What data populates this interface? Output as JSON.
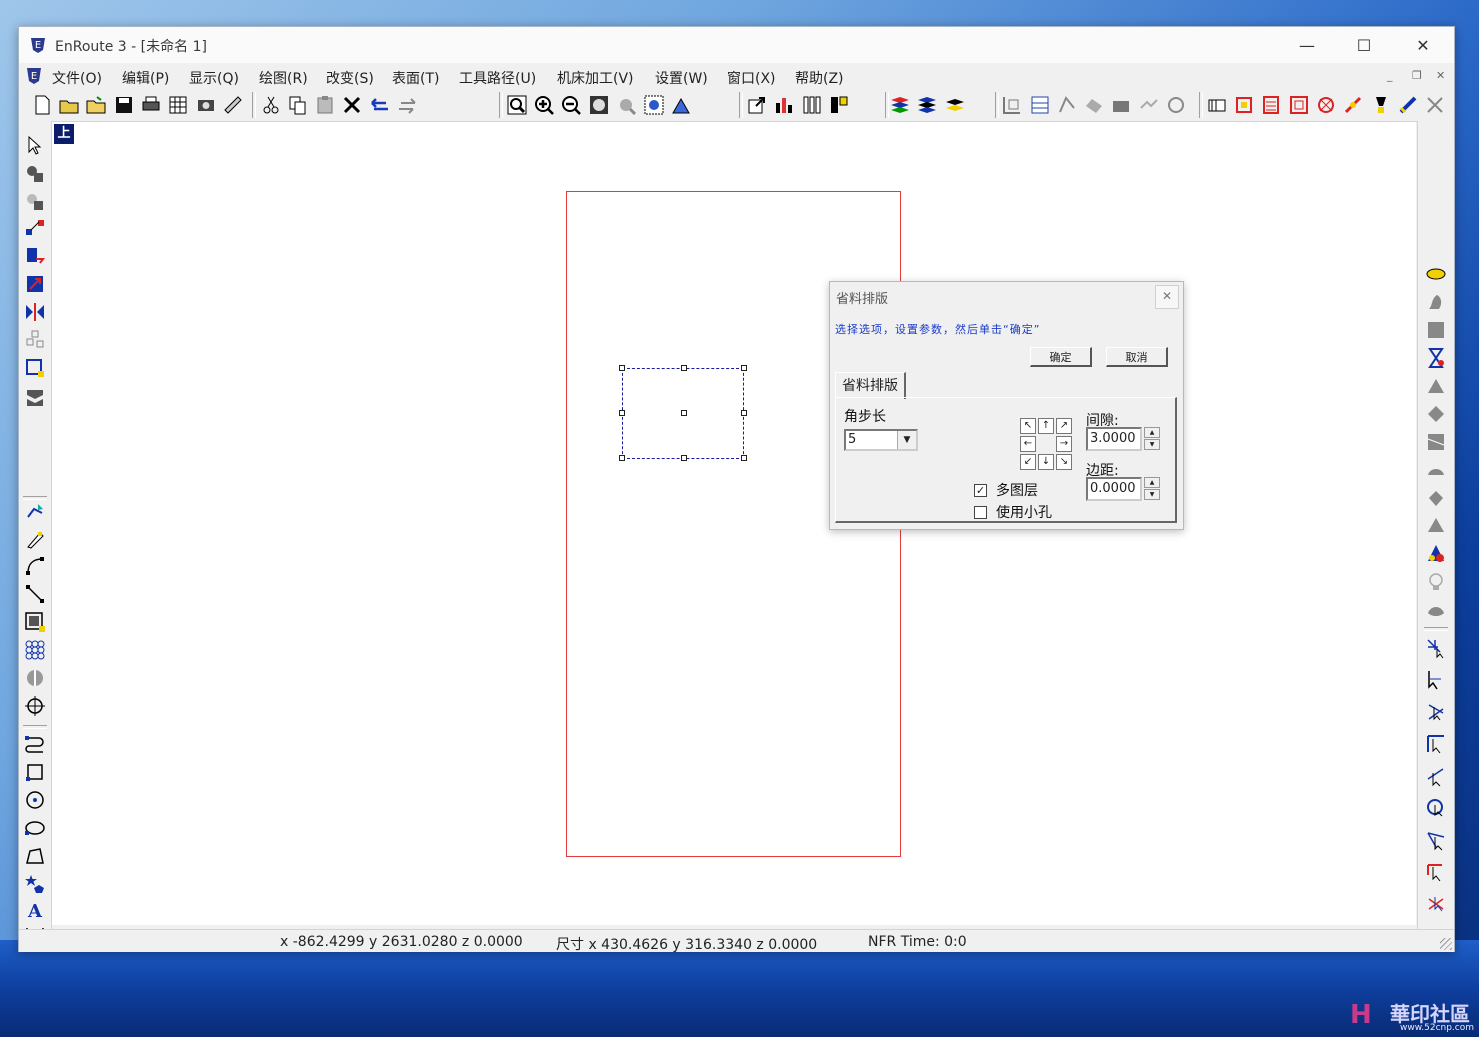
{
  "window": {
    "title": "EnRoute 3 - [未命名 1]",
    "controls": {
      "minimize": "—",
      "maximize": "☐",
      "close": "✕"
    }
  },
  "menu": {
    "items": [
      "文件(O)",
      "编辑(P)",
      "显示(Q)",
      "绘图(R)",
      "改变(S)",
      "表面(T)",
      "工具路径(U)",
      "机床加工(V)",
      "设置(W)",
      "窗口(X)",
      "帮助(Z)"
    ],
    "mdi_controls": {
      "minimize": "_",
      "restore": "❐",
      "close": "✕"
    }
  },
  "canvas": {
    "top_view_marker": "上",
    "colors": {
      "board_outline": "#e53a3a",
      "selection": "#1a1aa0",
      "marker": "#0b1d6a"
    }
  },
  "status": {
    "coords": "x -862.4299 y 2631.0280 z 0.0000",
    "size": "尺寸 x 430.4626 y 316.3340 z 0.0000",
    "nfr": "NFR Time: 0:0"
  },
  "dialog": {
    "title": "省料排版",
    "close": "✕",
    "prompt": "选择选项，设置参数，然后单击“确定”",
    "ok_label": "确定",
    "cancel_label": "取消",
    "tab_label": "省料排版",
    "angle_step_label": "角步长",
    "angle_step_value": "5",
    "gap_label": "间隙:",
    "gap_value": "3.0000",
    "margin_label": "边距:",
    "margin_value": "0.0000",
    "multi_layer_label": "多图层",
    "multi_layer_checked": true,
    "use_small_holes_label": "使用小孔",
    "use_small_holes_checked": false,
    "arrows": [
      "↖",
      "↑",
      "↗",
      "←",
      "",
      "→",
      "↙",
      "↓",
      "↘"
    ]
  },
  "watermark": {
    "logo": "H",
    "text": "華印社區",
    "url": "www.52cnp.com"
  }
}
